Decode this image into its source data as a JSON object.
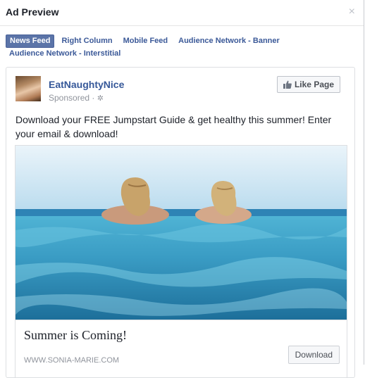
{
  "modal": {
    "title": "Ad Preview",
    "close_symbol": "×"
  },
  "tabs": [
    {
      "label": "News Feed",
      "active": true
    },
    {
      "label": "Right Column",
      "active": false
    },
    {
      "label": "Mobile Feed",
      "active": false
    },
    {
      "label": "Audience Network - Banner",
      "active": false
    },
    {
      "label": "Audience Network - Interstitial",
      "active": false
    }
  ],
  "post": {
    "page_name": "EatNaughtyNice",
    "sponsored": "Sponsored ·",
    "like_button": "Like Page",
    "text": "Download your FREE Jumpstart Guide & get healthy this summer! Enter your email & download!",
    "headline": "Summer is Coming!",
    "url": "WWW.SONIA-MARIE.COM",
    "cta": "Download"
  },
  "colors": {
    "link": "#365899",
    "tab_active_bg": "#5b74a8",
    "water": "#3aa6c9",
    "sky": "#c9e3f2"
  }
}
